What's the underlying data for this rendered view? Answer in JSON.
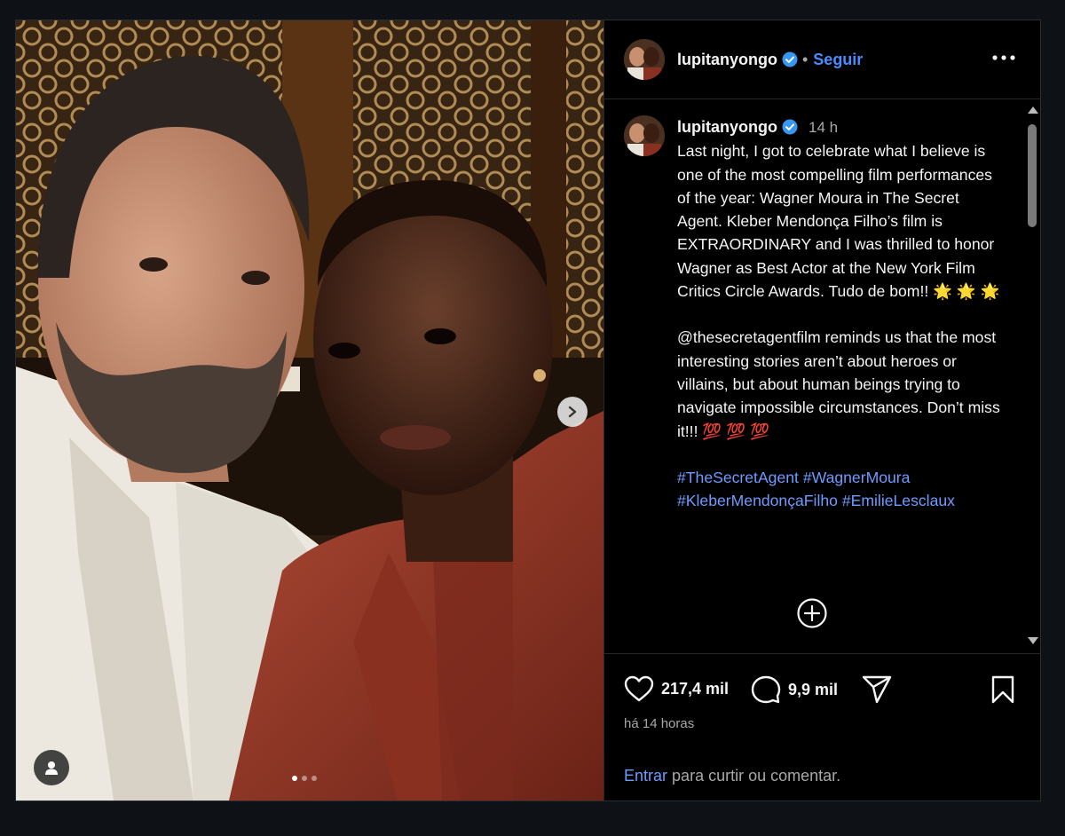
{
  "post": {
    "username": "lupitanyongo",
    "separator": "•",
    "follow_label": "Seguir",
    "time_short": "14 h",
    "caption": {
      "p1": "Last night, I got to celebrate what I believe is one of the most compelling film performances of the year: Wagner Moura in The Secret Agent. Kleber Mendonça Filho’s film is EXTRAORDINARY and I was thrilled to honor Wagner as Best Actor at the New York Film Critics Circle Awards. Tudo de bom!! 🌟 🌟 🌟",
      "p2": "@thesecretagentfilm reminds us that the most interesting stories aren’t about heroes or villains, but about human beings trying to navigate impossible circumstances. Don’t miss it!!! 💯 💯 💯",
      "hashtags": [
        "#TheSecretAgent",
        "#WagnerMoura",
        "#KleberMendonçaFilho",
        "#EmilieLesclaux"
      ]
    },
    "likes": "217,4 mil",
    "comments": "9,9 mil",
    "time_ago": "há 14 horas",
    "login_link": "Entrar",
    "login_text": "para curtir ou comentar.",
    "carousel": {
      "current": 1,
      "total": 3
    }
  },
  "colors": {
    "link": "#6c9cff",
    "follow": "#4a8cff",
    "verified": "#3797f0"
  },
  "icons": [
    "next-chevron-icon",
    "user-tag-icon",
    "verified-badge-icon",
    "more-options-icon",
    "plus-circle-icon",
    "heart-icon",
    "comment-icon",
    "share-icon",
    "bookmark-icon"
  ]
}
